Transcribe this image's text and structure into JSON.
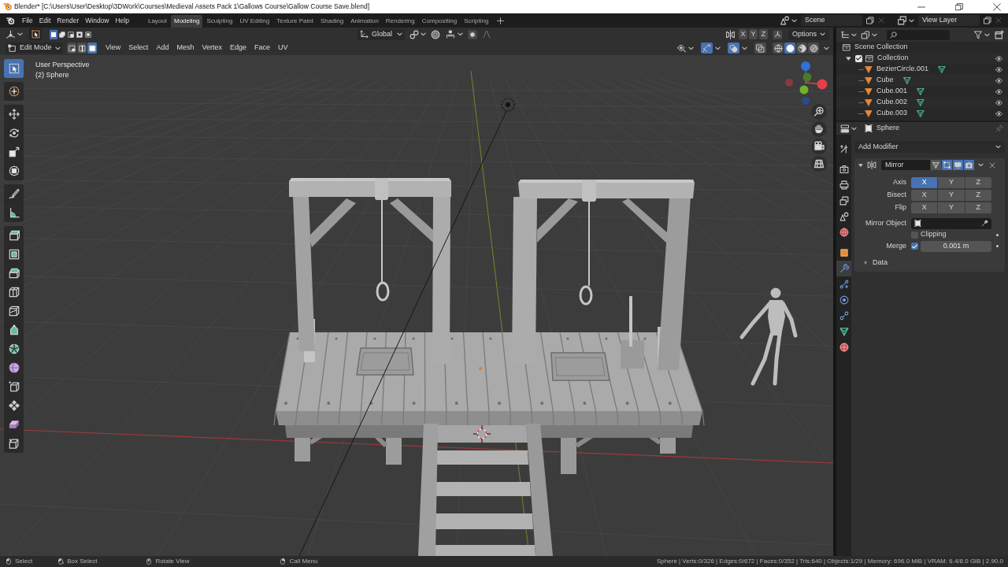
{
  "window": {
    "title": "Blender* [C:\\Users\\User\\Desktop\\3DWork\\Courses\\Medieval Assets Pack 1\\Gallows Course\\Gallow Course Save.blend]"
  },
  "menu_bar": [
    "File",
    "Edit",
    "Render",
    "Window",
    "Help"
  ],
  "workspace_tabs": [
    {
      "label": "Layout",
      "selected": false
    },
    {
      "label": "Modeling",
      "selected": true
    },
    {
      "label": "Sculpting",
      "selected": false
    },
    {
      "label": "UV Editing",
      "selected": false
    },
    {
      "label": "Texture Paint",
      "selected": false
    },
    {
      "label": "Shading",
      "selected": false
    },
    {
      "label": "Animation",
      "selected": false
    },
    {
      "label": "Rendering",
      "selected": false
    },
    {
      "label": "Compositing",
      "selected": false
    },
    {
      "label": "Scripting",
      "selected": false
    }
  ],
  "scene_selector": {
    "value": "Scene"
  },
  "view_layer_selector": {
    "value": "View Layer"
  },
  "viewport_header": {
    "select_modes": [
      {
        "kind": "set",
        "selected": true
      },
      {
        "kind": "extend",
        "selected": false
      },
      {
        "kind": "subtract",
        "selected": false
      },
      {
        "kind": "invert",
        "selected": false
      },
      {
        "kind": "intersect",
        "selected": false
      }
    ],
    "transform_orientation": "Global",
    "mirror_axes": [
      {
        "label": "X",
        "selected": false
      },
      {
        "label": "Y",
        "selected": false
      },
      {
        "label": "Z",
        "selected": false
      }
    ],
    "options": "Options",
    "mode": "Edit Mode",
    "mesh_select_modes": [
      {
        "kind": "vertex",
        "selected": false
      },
      {
        "kind": "edge",
        "selected": false
      },
      {
        "kind": "face",
        "selected": true
      }
    ],
    "menus": [
      "View",
      "Select",
      "Add",
      "Mesh",
      "Vertex",
      "Edge",
      "Face",
      "UV"
    ],
    "gizmos_on": true,
    "overlays_on": true,
    "xray_on": false,
    "shading": [
      {
        "kind": "wireframe",
        "selected": false
      },
      {
        "kind": "solid",
        "selected": true
      },
      {
        "kind": "material",
        "selected": false
      },
      {
        "kind": "rendered",
        "selected": false
      }
    ]
  },
  "viewport": {
    "view_name": "User Perspective",
    "object_label": "(2) Sphere",
    "tool_groups": [
      [
        {
          "kind": "select_box",
          "selected": true
        }
      ],
      [
        {
          "kind": "cursor",
          "selected": false
        }
      ],
      [
        {
          "kind": "move",
          "selected": false
        },
        {
          "kind": "rotate",
          "selected": false
        },
        {
          "kind": "scale",
          "selected": false
        },
        {
          "kind": "transform",
          "selected": false
        }
      ],
      [
        {
          "kind": "annotate",
          "selected": false
        },
        {
          "kind": "measure",
          "selected": false
        }
      ],
      [
        {
          "kind": "extrude",
          "selected": false
        },
        {
          "kind": "inset",
          "selected": false
        },
        {
          "kind": "bevel",
          "selected": false
        },
        {
          "kind": "loop_cut",
          "selected": false
        },
        {
          "kind": "knife",
          "selected": false
        },
        {
          "kind": "poly_build",
          "selected": false
        },
        {
          "kind": "spin",
          "selected": false
        },
        {
          "kind": "smooth",
          "selected": false
        },
        {
          "kind": "edge_slide",
          "selected": false
        },
        {
          "kind": "shrink_fatten",
          "selected": false
        },
        {
          "kind": "shear",
          "selected": false
        },
        {
          "kind": "rip",
          "selected": false
        }
      ]
    ]
  },
  "outliner": {
    "root": "Scene Collection",
    "items": [
      {
        "label": "Collection",
        "checked": true,
        "expanded": true,
        "visible": true,
        "children": [
          {
            "label": "BezierCircle.001",
            "visible": true
          },
          {
            "label": "Cube",
            "visible": true
          },
          {
            "label": "Cube.001",
            "visible": true
          },
          {
            "label": "Cube.002",
            "visible": true
          },
          {
            "label": "Cube.003",
            "visible": true
          }
        ]
      }
    ]
  },
  "properties": {
    "object_name": "Sphere",
    "tab_groups": [
      [
        {
          "kind": "tool",
          "selected": false
        }
      ],
      [
        {
          "kind": "render",
          "selected": false
        },
        {
          "kind": "output",
          "selected": false
        },
        {
          "kind": "view_layer",
          "selected": false
        },
        {
          "kind": "scene",
          "selected": false
        },
        {
          "kind": "world",
          "selected": false
        }
      ],
      [
        {
          "kind": "object",
          "selected": false
        },
        {
          "kind": "modifiers",
          "selected": true
        },
        {
          "kind": "particles",
          "selected": false
        },
        {
          "kind": "physics",
          "selected": false
        },
        {
          "kind": "constraints",
          "selected": false
        },
        {
          "kind": "data",
          "selected": false
        },
        {
          "kind": "material",
          "selected": false
        }
      ]
    ],
    "add_modifier": "Add Modifier",
    "modifier": {
      "name": "Mirror",
      "expanded": true,
      "toggles": [
        {
          "kind": "on_cage",
          "on": false
        },
        {
          "kind": "edit_mode",
          "on": true
        },
        {
          "kind": "realtime",
          "on": true
        },
        {
          "kind": "render",
          "on": true
        }
      ],
      "rows": [
        {
          "kind": "toggle_row",
          "label": "Axis",
          "options": [
            {
              "label": "X",
              "selected": true
            },
            {
              "label": "Y",
              "selected": false
            },
            {
              "label": "Z",
              "selected": false
            }
          ]
        },
        {
          "kind": "toggle_row",
          "label": "Bisect",
          "options": [
            {
              "label": "X",
              "selected": false
            },
            {
              "label": "Y",
              "selected": false
            },
            {
              "label": "Z",
              "selected": false
            }
          ]
        },
        {
          "kind": "toggle_row",
          "label": "Flip",
          "options": [
            {
              "label": "X",
              "selected": false
            },
            {
              "label": "Y",
              "selected": false
            },
            {
              "label": "Z",
              "selected": false
            }
          ]
        },
        {
          "kind": "object_field",
          "label": "Mirror Object"
        },
        {
          "kind": "checkbox",
          "label": "Clipping",
          "checked": false
        },
        {
          "kind": "checkbox_value",
          "label": "Merge",
          "checked": true,
          "value": "0.001 m"
        }
      ],
      "subpanels": [
        {
          "label": "Data",
          "expanded": false
        }
      ]
    }
  },
  "status_bar": {
    "hints": [
      {
        "label": "Select",
        "kind": "left_click"
      },
      {
        "label": "Box Select",
        "kind": "left_drag"
      },
      {
        "label": "Rotate View",
        "kind": "middle_drag"
      },
      {
        "label": "Call Menu",
        "kind": "right_click"
      }
    ],
    "stats": "Sphere | Verts:0/326 | Edges:0/672 | Faces:0/352 | Tris:640 | Objects:1/29 | Memory: 696.0 MiB | VRAM: 6.4/8.0 GiB | 2.90.0"
  }
}
